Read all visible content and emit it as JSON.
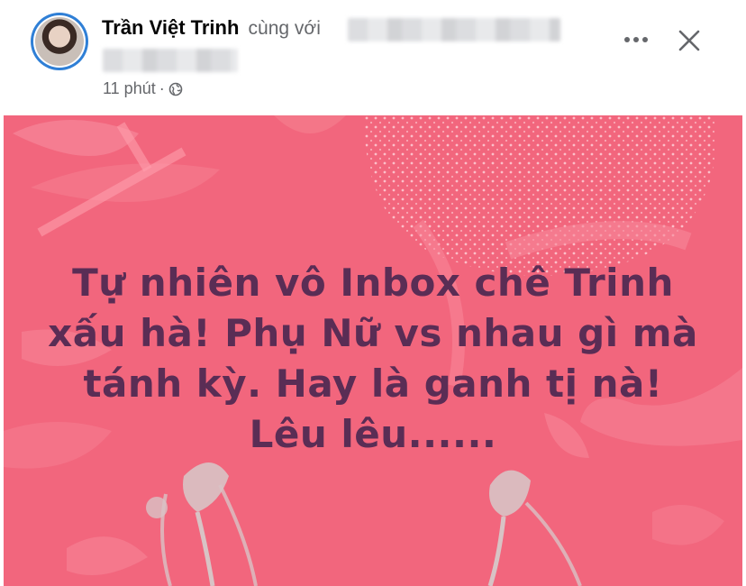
{
  "header": {
    "author_name": "Trần Việt Trinh",
    "with_text": "cùng với",
    "timestamp": "11 phút",
    "separator": "·",
    "privacy_icon": "globe-icon",
    "more_icon": "more-options-icon",
    "close_icon": "close-icon"
  },
  "post": {
    "background_color": "#f2667d",
    "text_color": "#5a2d55",
    "lines": [
      "Tự nhiên vô Inbox chê Trinh",
      "xấu hà! Phụ Nữ vs nhau gì mà",
      "tánh kỳ. Hay là ganh tị nà!",
      "Lêu lêu......"
    ]
  }
}
